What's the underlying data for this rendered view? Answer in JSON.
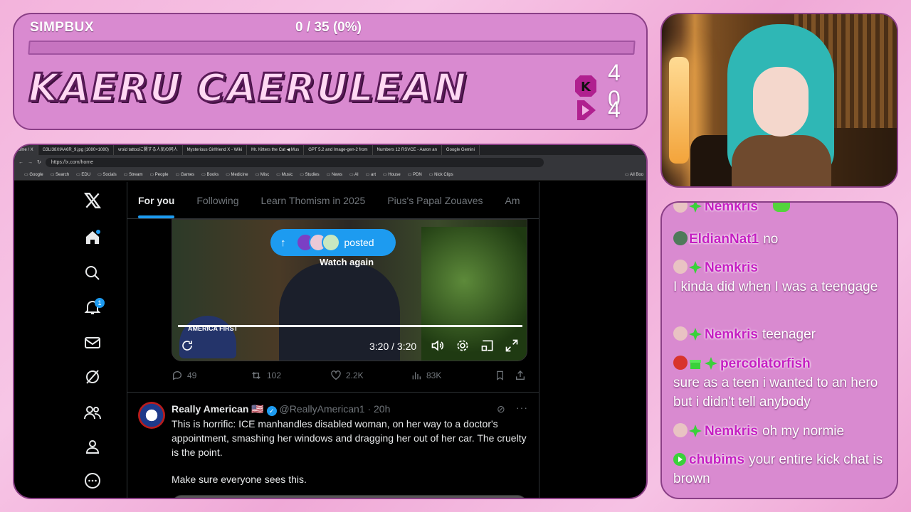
{
  "overlay": {
    "simpbux_label": "SIMPBUX",
    "progress_text": "0 / 35 (0%)",
    "progress_fraction": 0,
    "title": "KAERU CAERULEAN",
    "stats": [
      {
        "icon": "kick-icon",
        "value": "4 0"
      },
      {
        "icon": "play-icon",
        "value": "4"
      }
    ]
  },
  "browser": {
    "tabs": [
      "ome / X",
      "G3LI38XfAA6R_9.jpg (1080×1080)",
      "vroid tattooに関する人気の同人",
      "Mysterious Girlfriend X - Wiki",
      "Mr. Kitters the Cat ◀ Mus",
      "GPT 5.2 and Image-gen-2 from",
      "Numbers 12 RSVCE - Aaron an",
      "Google Gemini"
    ],
    "url": "https://x.com/home",
    "bookmarks": [
      "Google",
      "Search",
      "EDU",
      "Socials",
      "Stream",
      "People",
      "Games",
      "Books",
      "Medicine",
      "Misc",
      "Music",
      "Studies",
      "News",
      "AI",
      "art",
      "House",
      "PDN",
      "Nick Clips"
    ],
    "all_bookmarks": "All Boo"
  },
  "x": {
    "notification_count": "1",
    "feed_tabs": [
      "For you",
      "Following",
      "Learn Thomism in 2025",
      "Pius's Papal Zouaves",
      "Am"
    ],
    "video": {
      "posted_label": "posted",
      "watch_again": "Watch again",
      "time": "3:20 / 3:20",
      "cap_text": "AMERICA FIRST"
    },
    "actions": {
      "replies": "49",
      "reposts": "102",
      "likes": "2.2K",
      "views": "83K"
    },
    "tweet": {
      "name": "Really American 🇺🇸",
      "handle": "@ReallyAmerican1 · 20h",
      "line1": "This is horrific: ICE manhandles disabled woman, on her way to a doctor's appointment, smashing her windows and dragging her out of her car. The cruelty is the point.",
      "line2": "Make sure everyone sees this."
    }
  },
  "chat": [
    {
      "user": "Nemkris",
      "text": ""
    },
    {
      "user": "EldianNat1",
      "text": "no"
    },
    {
      "user": "Nemkris",
      "text": ""
    },
    {
      "user": "",
      "text": "I kinda did when I was a teengage"
    },
    {
      "user": "Nemkris",
      "text": "teenager"
    },
    {
      "user": "percolatorfish",
      "text": ""
    },
    {
      "user": "",
      "text": "sure as a teen i wanted to an hero but i didn't tell anybody"
    },
    {
      "user": "Nemkris",
      "text": "oh my normie"
    },
    {
      "user": "chubims",
      "text": "your entire kick chat is brown"
    }
  ],
  "colors": {
    "accent": "#1d9bf0",
    "panel": "#d98ad0",
    "username": "#c51fc2"
  }
}
